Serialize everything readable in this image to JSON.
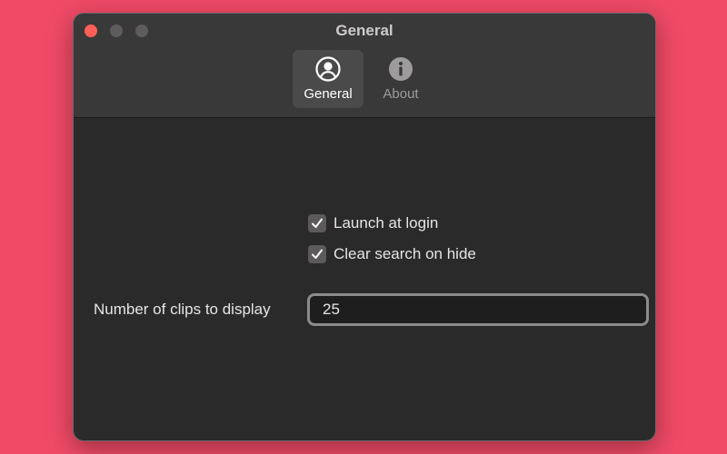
{
  "window": {
    "title": "General"
  },
  "toolbar": {
    "tabs": [
      {
        "label": "General",
        "icon": "person-circle-icon",
        "selected": true
      },
      {
        "label": "About",
        "icon": "info-icon",
        "selected": false
      }
    ]
  },
  "settings": {
    "launch_at_login": {
      "label": "Launch at login",
      "checked": true
    },
    "clear_search_on_hide": {
      "label": "Clear search on hide",
      "checked": true
    },
    "clips_count": {
      "label": "Number of clips to display",
      "value": "25"
    }
  },
  "colors": {
    "background": "#f04a66",
    "window": "#2b2a2b",
    "toolbar": "#3a3939",
    "close_button": "#fe5f57"
  }
}
